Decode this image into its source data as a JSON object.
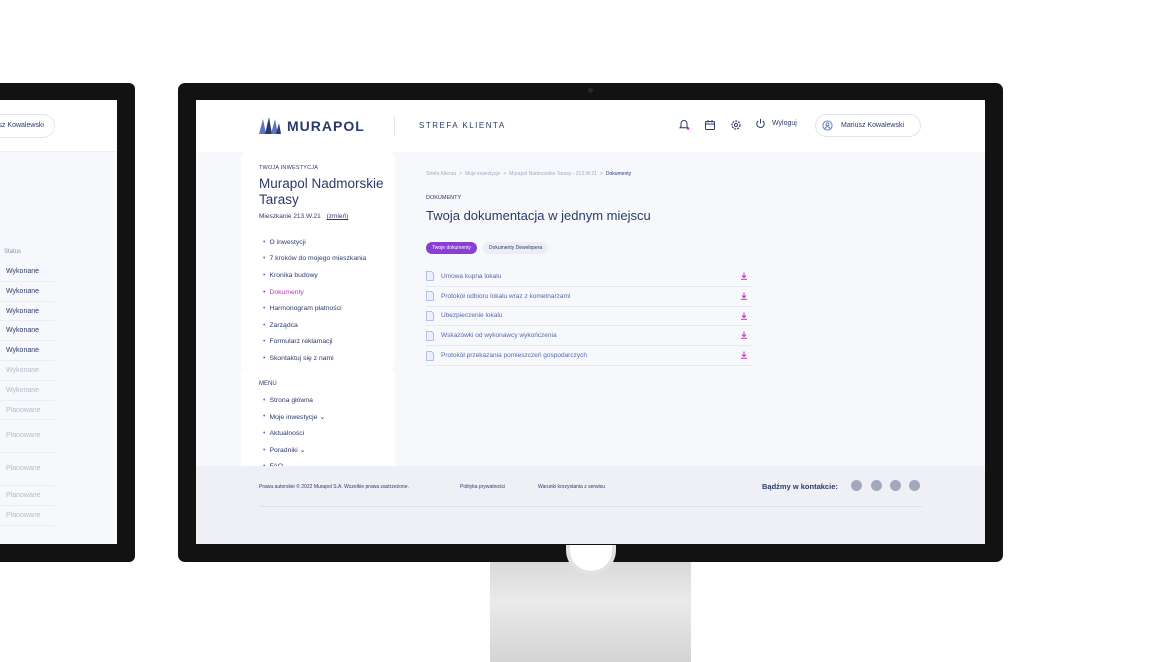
{
  "left_monitor": {
    "user_name": "Mariusz Kowalewski",
    "status_header": "Status",
    "status_rows": [
      "Wykonane",
      "Wykonane",
      "Wykonane",
      "Wykonane",
      "Wykonane",
      "Wykonane",
      "Wykonane",
      "Planowane",
      "Planowane",
      "Planowane",
      "Planowane",
      "Planowane"
    ]
  },
  "header": {
    "brand": "MURAPOL",
    "section": "STREFA KLIENTA",
    "logout_label": "Wyloguj",
    "user_name": "Mariusz Kowalewski"
  },
  "sidebar": {
    "label": "TWOJA INWESTYCJA",
    "title": "Murapol Nadmorskie Tarasy",
    "apartment": "Mieszkanie 213.W.21",
    "change_label": "(zmień)",
    "items": [
      {
        "label": "O inwestycji"
      },
      {
        "label": "7 kroków do mojego mieszkania"
      },
      {
        "label": "Kronika budowy"
      },
      {
        "label": "Dokumenty"
      },
      {
        "label": "Harmonogram płatności"
      },
      {
        "label": "Zarządca"
      },
      {
        "label": "Formularz reklamacji"
      },
      {
        "label": "Skontaktuj się z nami"
      }
    ],
    "active_item": "Dokumenty"
  },
  "menu": {
    "label": "MENU",
    "items": [
      {
        "label": "Strona główna"
      },
      {
        "label": "Moje inwestycje ⌄"
      },
      {
        "label": "Aktualności"
      },
      {
        "label": "Poradniki ⌄"
      },
      {
        "label": "FAQ"
      }
    ]
  },
  "content": {
    "breadcrumb": [
      "Strefa Klienta",
      "Moje inwestycje",
      "Murapol Nadmorskie Tarasy - 213.W.21",
      "Dokumenty"
    ],
    "category": "DOKUMENTY",
    "title": "Twoja dokumentacja w jednym miejscu",
    "tabs": [
      {
        "label": "Twoje dokumenty",
        "active": true
      },
      {
        "label": "Dokumenty Dewelopera",
        "active": false
      }
    ],
    "documents": [
      {
        "name": "Umowa kupna lokalu"
      },
      {
        "name": "Protokół odbioru lokalu wraz z kometnarzami"
      },
      {
        "name": "Ubezpieczenie lokalu"
      },
      {
        "name": "Wskazówki od wykonawcy wykończenia"
      },
      {
        "name": "Protokół przekazania pomieszczeń gospodarczych"
      }
    ]
  },
  "footer": {
    "copyright": "Prawa autorskie © 2022 Murapol S.A. Wszelkie prawa zastrzeżone.",
    "privacy": "Polityka prywatności",
    "terms": "Warunki korzystania z serwisu",
    "contact_label": "Bądźmy w kontakcie:",
    "socials": [
      "twitter-icon",
      "linkedin-icon",
      "youtube-icon",
      "instagram-icon"
    ]
  },
  "colors": {
    "brand_navy": "#2b3a6b",
    "accent_magenta": "#c62fc0",
    "tab_active": "#8a3fd4"
  }
}
